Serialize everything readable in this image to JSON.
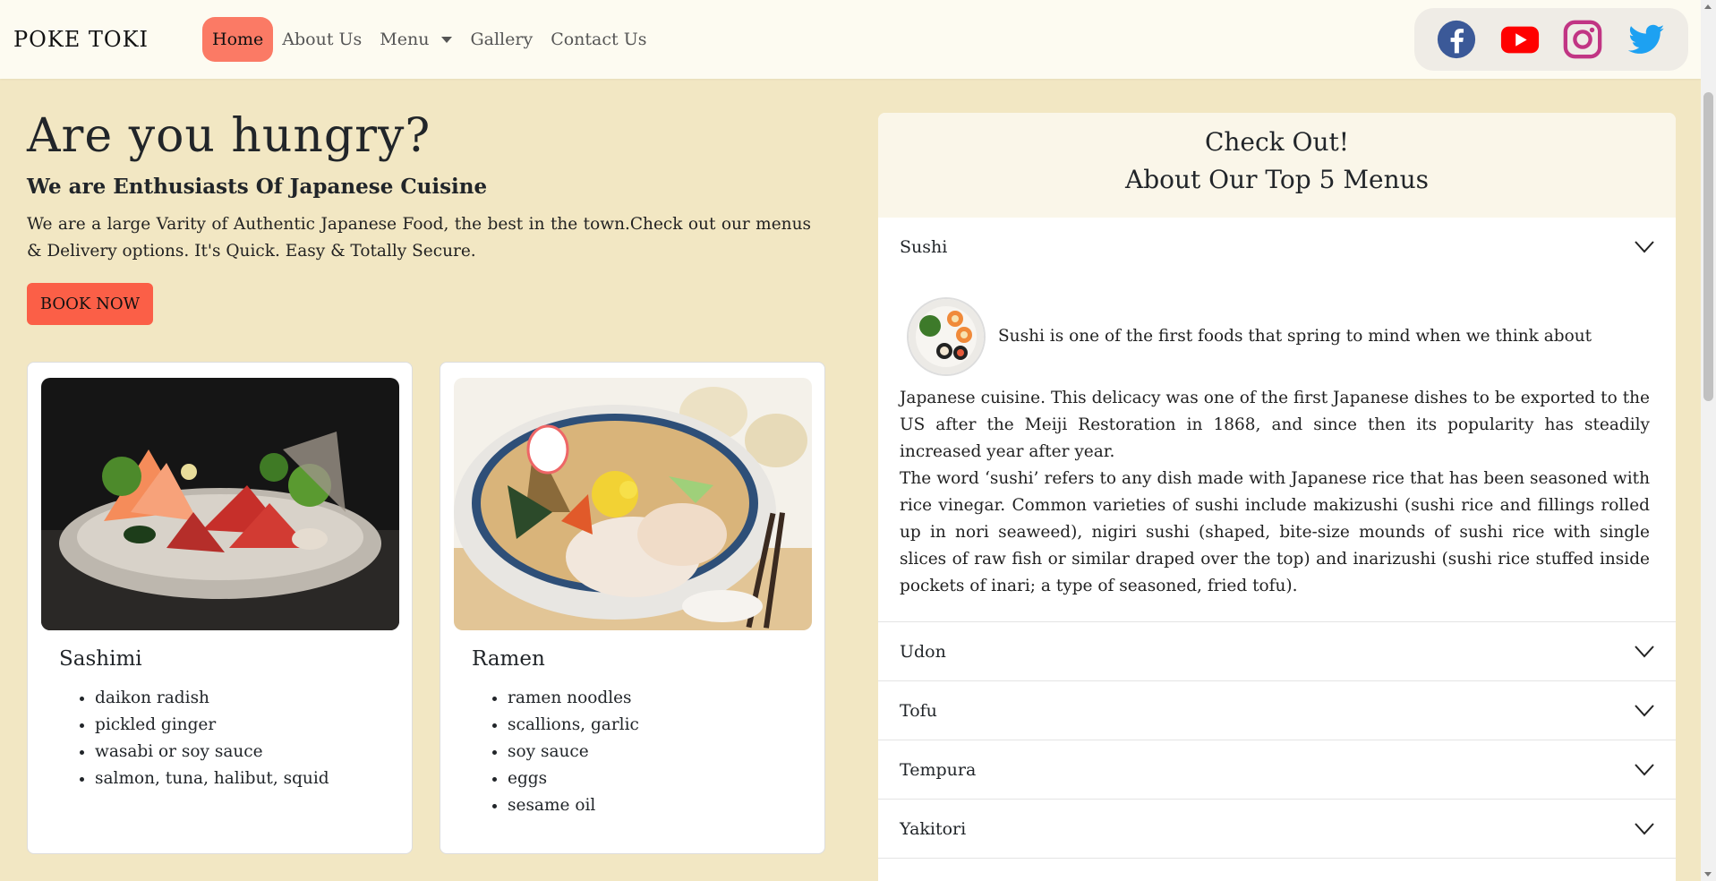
{
  "navbar": {
    "brand": "POKE TOKI",
    "links": [
      {
        "label": "Home"
      },
      {
        "label": "About Us"
      },
      {
        "label": "Menu"
      },
      {
        "label": "Gallery"
      },
      {
        "label": "Contact Us"
      }
    ],
    "social": [
      {
        "icon": "facebook-icon",
        "color": "#3b5998"
      },
      {
        "icon": "youtube-icon",
        "color": "#ff0000"
      },
      {
        "icon": "instagram-icon",
        "color": "#c13584"
      },
      {
        "icon": "twitter-icon",
        "color": "#1da1f2"
      }
    ]
  },
  "hero": {
    "title": "Are you hungry?",
    "subtitle": "We are Enthusiasts Of Japanese Cuisine",
    "text": "We are a large Varity of Authentic Japanese Food, the best in the town.Check out our menus & Delivery options. It's Quick. Easy & Totally Secure.",
    "button": "BOOK NOW",
    "button_color": "#fb5f47"
  },
  "cards": [
    {
      "title": "Sashimi",
      "items": [
        "daikon radish",
        "pickled ginger",
        "wasabi or soy sauce",
        "salmon, tuna, halibut, squid"
      ]
    },
    {
      "title": "Ramen",
      "items": [
        "ramen noodles",
        "scallions, garlic",
        "soy sauce",
        "eggs",
        "sesame oil"
      ]
    }
  ],
  "accordion": {
    "heading_line1": "Check Out!",
    "heading_line2": "About Our Top 5 Menus",
    "items": [
      {
        "label": "Sushi",
        "expanded": true,
        "lead": "Sushi is one of the first foods that spring to mind when we think about",
        "para1": "Japanese cuisine. This delicacy was one of the first Japanese dishes to be exported to the US after the Meiji Restoration in 1868, and since then its popularity has steadily increased year after year.",
        "para2": "The word ‘sushi’ refers to any dish made with Japanese rice that has been seasoned with rice vinegar. Common varieties of sushi include makizushi (sushi rice and fillings rolled up in nori seaweed), nigiri sushi (shaped, bite-size mounds of sushi rice with single slices of raw fish or similar draped over the top) and inarizushi (sushi rice stuffed inside pockets of inari; a type of seasoned, fried tofu)."
      },
      {
        "label": "Udon",
        "expanded": false
      },
      {
        "label": "Tofu",
        "expanded": false
      },
      {
        "label": "Tempura",
        "expanded": false
      },
      {
        "label": "Yakitori",
        "expanded": false
      }
    ]
  },
  "colors": {
    "page_bg": "#f2e7c3",
    "nav_bg": "#fdfbf1",
    "active_nav": "#fb7a65"
  }
}
